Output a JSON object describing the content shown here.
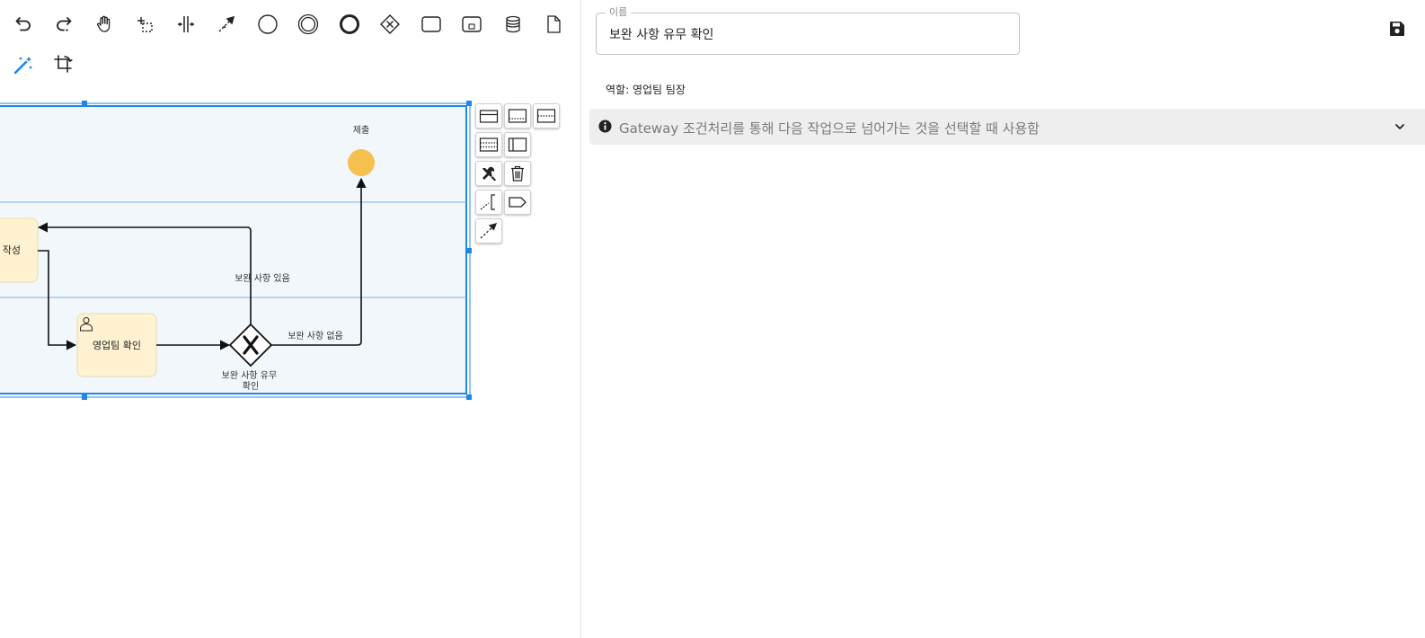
{
  "toolbar": {
    "tools": [
      {
        "icon": "undo-icon"
      },
      {
        "icon": "redo-icon"
      },
      {
        "icon": "hand-tool-icon"
      },
      {
        "icon": "lasso-tool-icon"
      },
      {
        "icon": "space-tool-icon"
      },
      {
        "icon": "global-connect-icon"
      },
      {
        "icon": "start-event-icon"
      },
      {
        "icon": "intermediate-event-icon"
      },
      {
        "icon": "end-event-icon"
      },
      {
        "icon": "gateway-icon"
      },
      {
        "icon": "task-icon"
      },
      {
        "icon": "subprocess-icon"
      },
      {
        "icon": "data-store-icon"
      },
      {
        "icon": "data-object-icon"
      },
      {
        "icon": "magic-wand-icon"
      },
      {
        "icon": "crop-icon"
      }
    ]
  },
  "diagram": {
    "end_event_label": "제출",
    "task_left_label": "보완 작성",
    "task_sales_label": "영업팀 확인",
    "gateway_label": "보완 사항 유무 확인",
    "flow_yes_label": "보완 사항 있음",
    "flow_no_label": "보완 사항 없음",
    "colors": {
      "task_fill": "#fff2d1",
      "end_event_fill": "#f6c04e",
      "lane_fill": "#f1f7fb",
      "selection": "#1e88e5"
    }
  },
  "context_pad": {
    "buttons": [
      {
        "icon": "lane-insert-above-icon"
      },
      {
        "icon": "lane-divide-two-icon"
      },
      {
        "icon": "lane-divide-three-icon"
      },
      {
        "icon": "lane-insert-below-icon"
      },
      {
        "icon": "participant-icon"
      },
      {
        "icon": "wrench-icon"
      },
      {
        "icon": "trash-icon"
      },
      {
        "icon": "text-annotation-icon"
      },
      {
        "icon": "tag-icon"
      },
      {
        "icon": "connect-icon"
      }
    ]
  },
  "properties": {
    "name_label": "이름",
    "name_value": "보완 사항 유무 확인",
    "role_text": "역할: 영업팀 팀장",
    "info_text": "Gateway 조건처리를 통해 다음 작업으로 넘어가는 것을 선택할 때 사용함",
    "save_icon": "save-icon",
    "info_icon": "info-icon",
    "expand_icon": "chevron-down-icon"
  }
}
